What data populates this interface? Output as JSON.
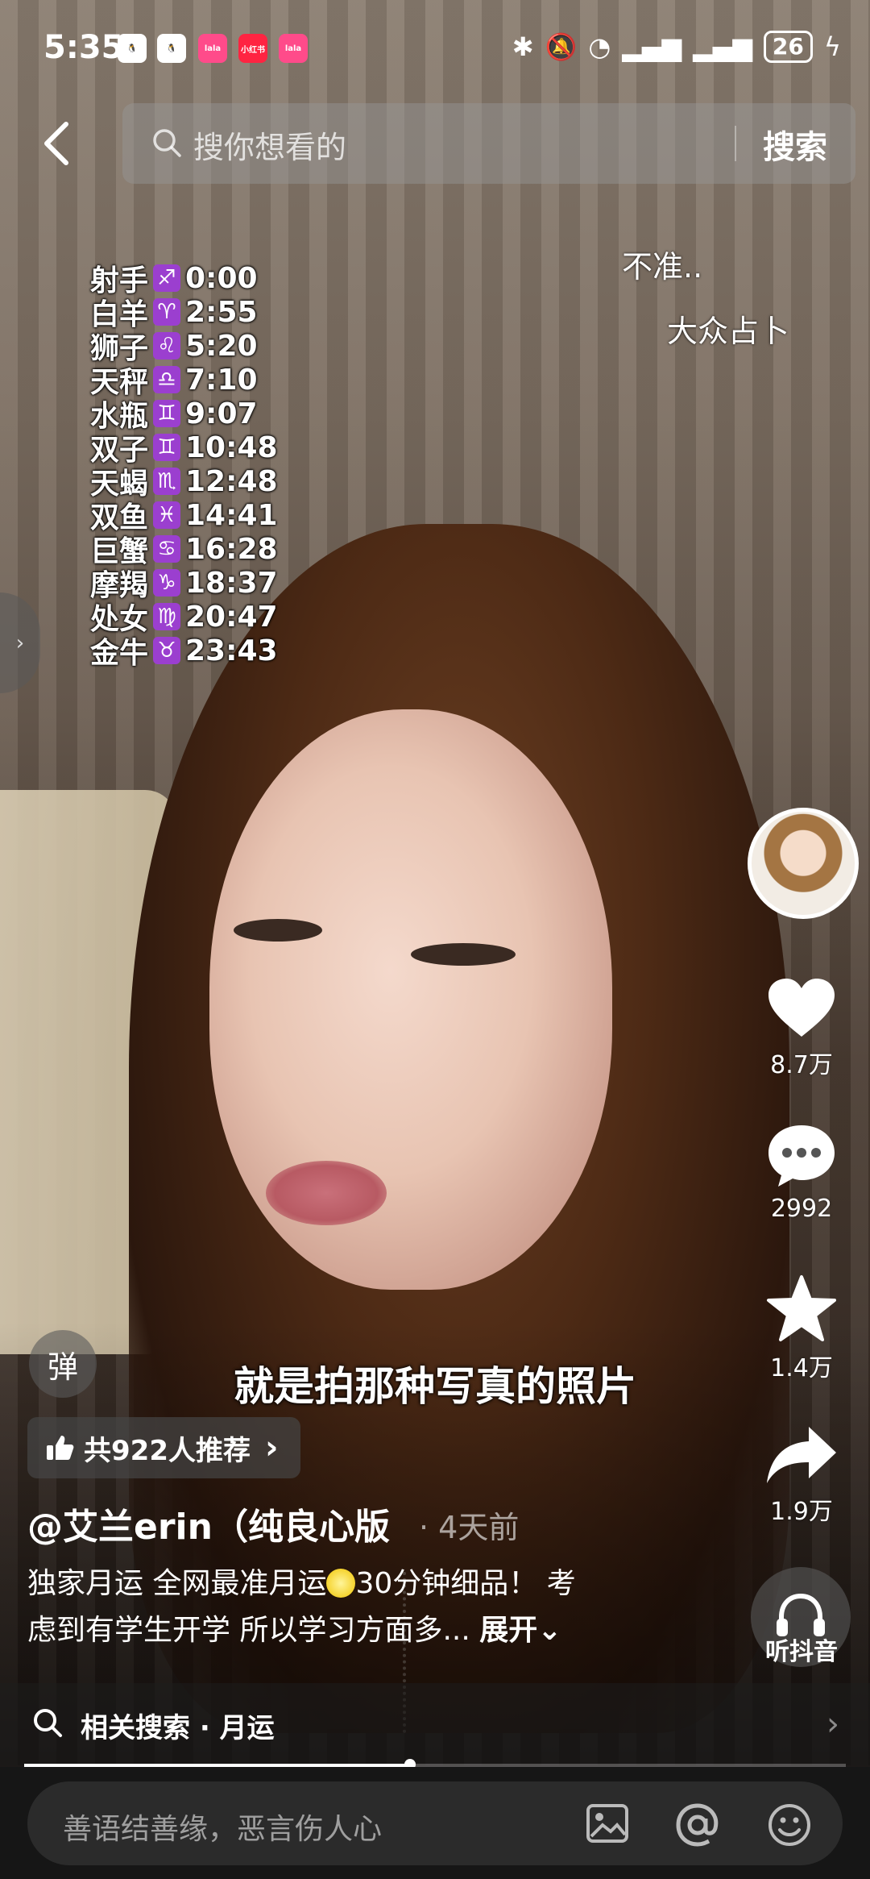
{
  "status_bar": {
    "time": "5:35",
    "apps": [
      {
        "name": "qq-icon",
        "label": "",
        "color": "#ffffff"
      },
      {
        "name": "qq-icon",
        "label": "",
        "color": "#ffffff"
      },
      {
        "name": "app-icon",
        "label": "lala",
        "color": "#ff4b8a"
      },
      {
        "name": "xiaohongshu-icon",
        "label": "小红书",
        "color": "#ff2442"
      },
      {
        "name": "app-icon",
        "label": "lala",
        "color": "#ff4b8a"
      }
    ],
    "battery": "26"
  },
  "search": {
    "placeholder": "搜你想看的",
    "button": "搜索"
  },
  "zodiac_overlay": [
    {
      "name": "射手",
      "sign": "♐",
      "time": "0:00"
    },
    {
      "name": "白羊",
      "sign": "♈",
      "time": "2:55"
    },
    {
      "name": "狮子",
      "sign": "♌",
      "time": "5:20"
    },
    {
      "name": "天秤",
      "sign": "♎",
      "time": "7:10"
    },
    {
      "name": "水瓶",
      "sign": "♊",
      "time": "9:07"
    },
    {
      "name": "双子",
      "sign": "♊",
      "time": "10:48"
    },
    {
      "name": "天蝎",
      "sign": "♏",
      "time": "12:48"
    },
    {
      "name": "双鱼",
      "sign": "♓",
      "time": "14:41"
    },
    {
      "name": "巨蟹",
      "sign": "♋",
      "time": "16:28"
    },
    {
      "name": "摩羯",
      "sign": "♑",
      "time": "18:37"
    },
    {
      "name": "处女",
      "sign": "♍",
      "time": "20:47"
    },
    {
      "name": "金牛",
      "sign": "♉",
      "time": "23:43"
    }
  ],
  "notes": {
    "line1": "不准..",
    "line2": "大众占卜"
  },
  "rail": {
    "likes": "8.7万",
    "comments": "2992",
    "favorites": "1.4万",
    "shares": "1.9万",
    "listen_label": "听抖音"
  },
  "danmu_label": "弹",
  "subtitle": "就是拍那种写真的照片",
  "recommend": "共922人推荐",
  "author": "@艾兰erin（纯良心版",
  "time_ago": "4天前",
  "description": {
    "line1_a": "独家月运 全网最准月运",
    "line1_b": "30分钟细品！ 考",
    "line2": "虑到有学生开学 所以学习方面多...",
    "expand": "展开"
  },
  "related": {
    "label": "相关搜索 · 月运"
  },
  "video_progress": 0.47,
  "comment_input": {
    "placeholder": "善语结善缘，恶言伤人心"
  },
  "colors": {
    "accent_zodiac": "#9b3fcf",
    "bottom_bar": "#161616"
  }
}
